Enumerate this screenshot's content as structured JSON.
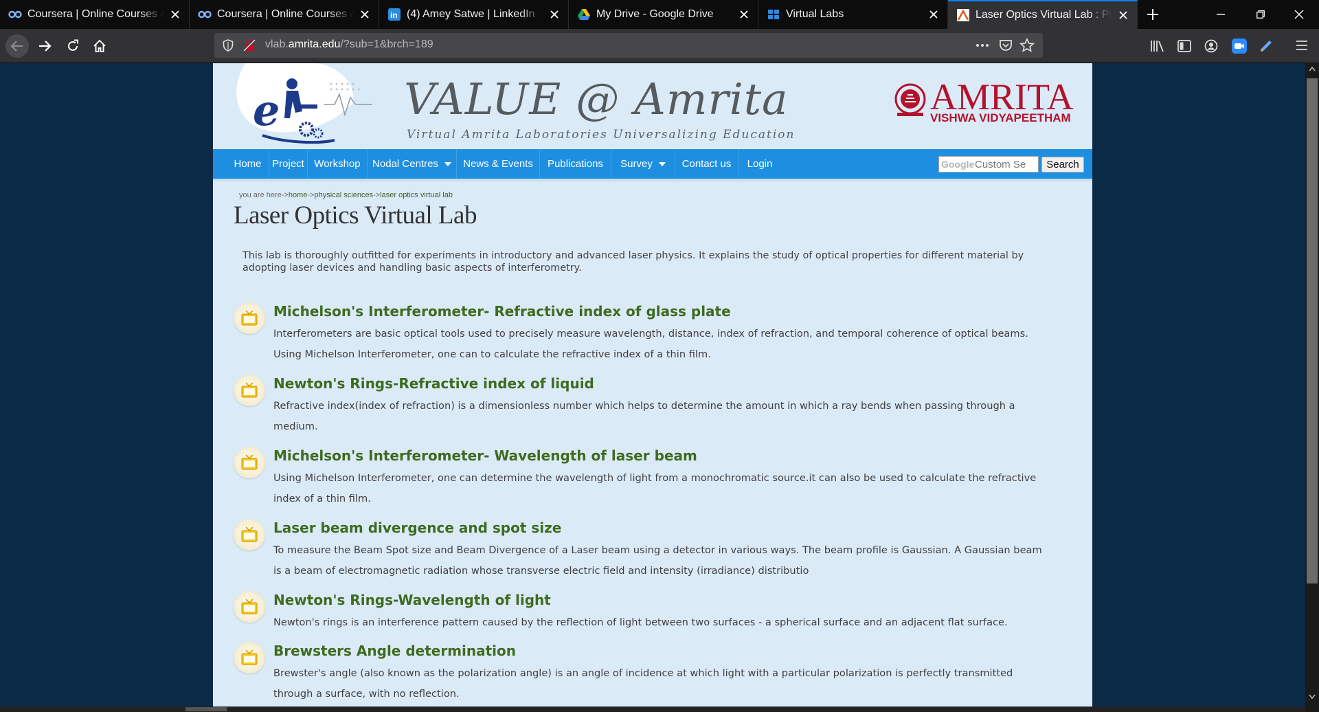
{
  "tabs": [
    {
      "label": "Coursera | Online Courses & Cr",
      "icon": "coursera-icon",
      "active": false
    },
    {
      "label": "Coursera | Online Courses & Cr",
      "icon": "coursera-icon",
      "active": false
    },
    {
      "label": "(4) Amey Satwe | LinkedIn",
      "icon": "linkedin-icon",
      "active": false
    },
    {
      "label": "My Drive - Google Drive",
      "icon": "google-drive-icon",
      "active": false
    },
    {
      "label": "Virtual Labs",
      "icon": "virtual-labs-icon",
      "active": false
    },
    {
      "label": "Laser Optics Virtual Lab : Physic",
      "icon": "vlab-favicon-icon",
      "active": true
    }
  ],
  "url": {
    "prefix": "vlab.",
    "host": "amrita.edu",
    "path": "/?sub=1&brch=189"
  },
  "site": {
    "title": "VALUE @ Amrita",
    "tagline": "Virtual Amrita Laboratories Universalizing Education",
    "logo_letter": "e",
    "amrita_name": "AMRITA",
    "amrita_sub": "VISHWA VIDYAPEETHAM"
  },
  "menu": [
    {
      "label": "Home",
      "dropdown": false
    },
    {
      "label": "Project",
      "dropdown": false
    },
    {
      "label": "Workshop",
      "dropdown": false
    },
    {
      "label": "Nodal Centres",
      "dropdown": true
    },
    {
      "label": "News & Events",
      "dropdown": false
    },
    {
      "label": "Publications",
      "dropdown": false
    },
    {
      "label": "Survey",
      "dropdown": true
    },
    {
      "label": "Contact us",
      "dropdown": false
    },
    {
      "label": "Login",
      "dropdown": false
    }
  ],
  "search": {
    "placeholder": "Custom Se",
    "brand": "Google",
    "button": "Search"
  },
  "breadcrumb": {
    "prefix": "you are here->",
    "items": [
      "home",
      "physical sciences",
      "laser optics virtual lab"
    ],
    "sep": "->"
  },
  "page_title": "Laser Optics Virtual Lab",
  "intro": "This lab is thoroughly outfitted for experiments in introductory and advanced laser physics. It explains the study of optical properties for different material by adopting laser devices and handling basic aspects of interferometry.",
  "experiments": [
    {
      "title": "Michelson's Interferometer- Refractive index of glass plate",
      "desc": "Interferometers are basic optical tools used to precisely measure wavelength, distance, index of refraction, and temporal coherence of optical beams. Using Michelson Interferometer, one can to calculate the refractive index of a thin film."
    },
    {
      "title": "Newton's Rings-Refractive index of liquid",
      "desc": "Refractive index(index of refraction) is a dimensionless number which helps to determine the amount in which a ray bends when passing through a medium."
    },
    {
      "title": "Michelson's Interferometer- Wavelength of laser beam",
      "desc": "Using Michelson Interferometer, one can determine the wavelength of light from a monochromatic source.it can also be used to calculate the refractive index of a thin film."
    },
    {
      "title": "Laser beam divergence and spot size",
      "desc": "To measure the Beam Spot size and Beam Divergence of a Laser beam using a detector in various ways. The beam profile is Gaussian. A Gaussian beam is a beam of electromagnetic radiation whose transverse electric field and intensity (irradiance) distributio"
    },
    {
      "title": "Newton's Rings-Wavelength of light",
      "desc": "Newton's rings is an interference pattern caused by the reflection of light between two surfaces - a spherical surface and an adjacent flat surface."
    },
    {
      "title": "Brewsters Angle determination",
      "desc": "Brewster's angle (also known as the polarization angle) is an angle of incidence at which light with a particular polarization is perfectly transmitted through a surface, with no reflection."
    }
  ],
  "colors": {
    "menu_bg": "#1e8fe0",
    "title_green": "#3e6b1f",
    "amrita_red": "#b3122d",
    "page_bg": "#dbeaf7"
  }
}
